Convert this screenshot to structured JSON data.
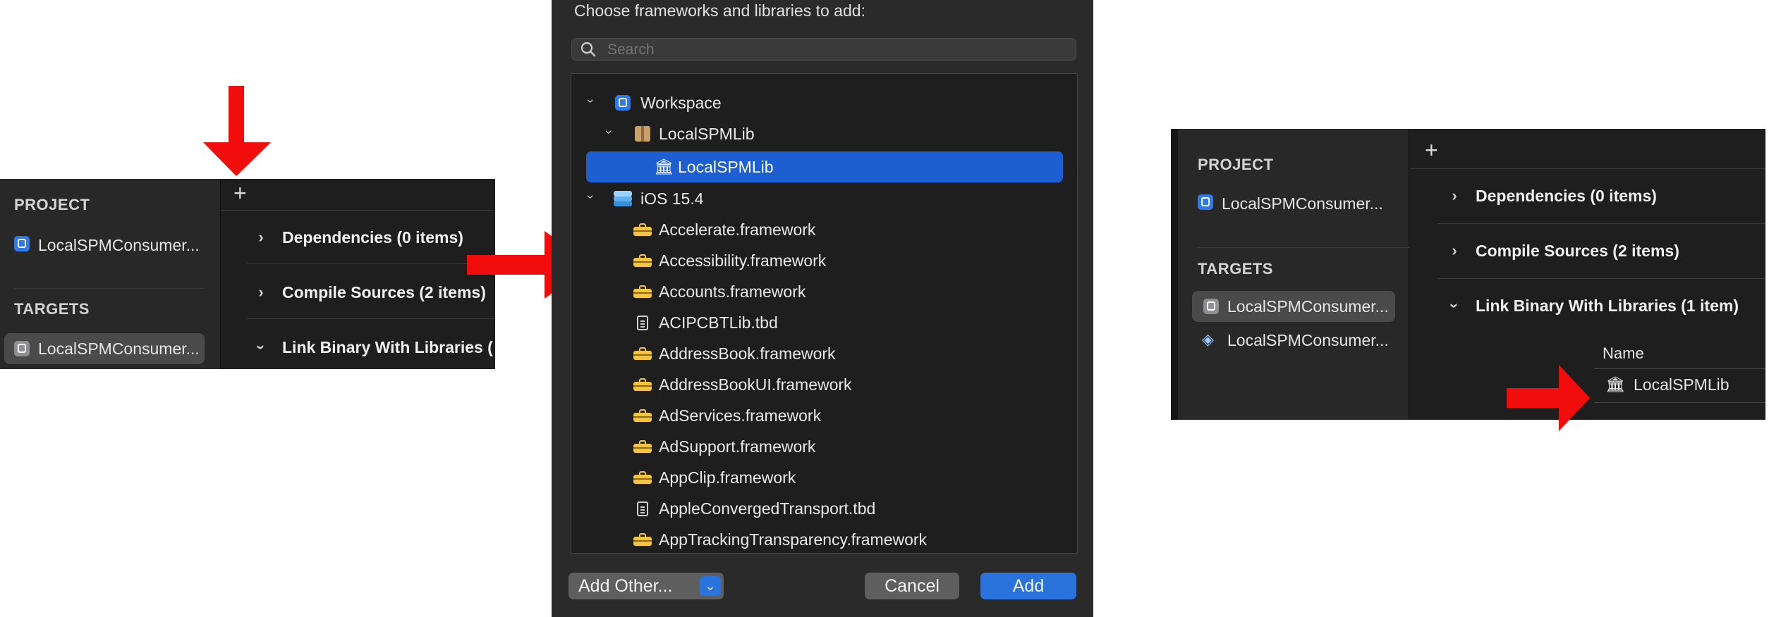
{
  "left_panel": {
    "project_header": "PROJECT",
    "project_item": "LocalSPMConsumer...",
    "targets_header": "TARGETS",
    "target_item": "LocalSPMConsumer...",
    "add_symbol": "+",
    "phases": [
      {
        "label": "Dependencies (0 items)",
        "expanded": false
      },
      {
        "label": "Compile Sources (2 items)",
        "expanded": false
      },
      {
        "label": "Link Binary With Libraries (",
        "expanded": true
      }
    ]
  },
  "dialog": {
    "prompt": "Choose frameworks and libraries to add:",
    "search_placeholder": "Search",
    "items": [
      {
        "label": "Workspace",
        "icon": "workspace-icon",
        "disclosure": "expanded"
      },
      {
        "label": "LocalSPMLib",
        "icon": "package-icon",
        "disclosure": "expanded"
      },
      {
        "label": "LocalSPMLib",
        "icon": "library-icon",
        "selected": true
      },
      {
        "label": "iOS 15.4",
        "icon": "sdk-icon",
        "disclosure": "expanded"
      },
      {
        "label": "Accelerate.framework",
        "icon": "toolbox-icon"
      },
      {
        "label": "Accessibility.framework",
        "icon": "toolbox-icon"
      },
      {
        "label": "Accounts.framework",
        "icon": "toolbox-icon"
      },
      {
        "label": "ACIPCBTLib.tbd",
        "icon": "document-icon"
      },
      {
        "label": "AddressBook.framework",
        "icon": "toolbox-icon"
      },
      {
        "label": "AddressBookUI.framework",
        "icon": "toolbox-icon"
      },
      {
        "label": "AdServices.framework",
        "icon": "toolbox-icon"
      },
      {
        "label": "AdSupport.framework",
        "icon": "toolbox-icon"
      },
      {
        "label": "AppClip.framework",
        "icon": "toolbox-icon"
      },
      {
        "label": "AppleConvergedTransport.tbd",
        "icon": "document-icon"
      },
      {
        "label": "AppTrackingTransparency.framework",
        "icon": "toolbox-icon"
      }
    ],
    "add_other_label": "Add Other...",
    "cancel_label": "Cancel",
    "add_label": "Add"
  },
  "right_panel": {
    "project_header": "PROJECT",
    "project_item": "LocalSPMConsumer...",
    "targets_header": "TARGETS",
    "targets": [
      {
        "label": "LocalSPMConsumer...",
        "icon": "app-icon",
        "selected": true
      },
      {
        "label": "LocalSPMConsumer...",
        "icon": "test-target-icon",
        "selected": false
      }
    ],
    "add_symbol": "+",
    "phases": [
      {
        "label": "Dependencies (0 items)",
        "expanded": false
      },
      {
        "label": "Compile Sources (2 items)",
        "expanded": false
      },
      {
        "label": "Link Binary With Libraries (1 item)",
        "expanded": true
      }
    ],
    "table_header": "Name",
    "library_row": "LocalSPMLib"
  },
  "colors": {
    "arrow": "#f20d0d",
    "selection_blue": "#1d5fd2",
    "button_blue": "#2a73dc",
    "panel_dark": "#1e1e1e",
    "sidebar_dark": "#282828",
    "framework_yellow": "#f5c542"
  }
}
